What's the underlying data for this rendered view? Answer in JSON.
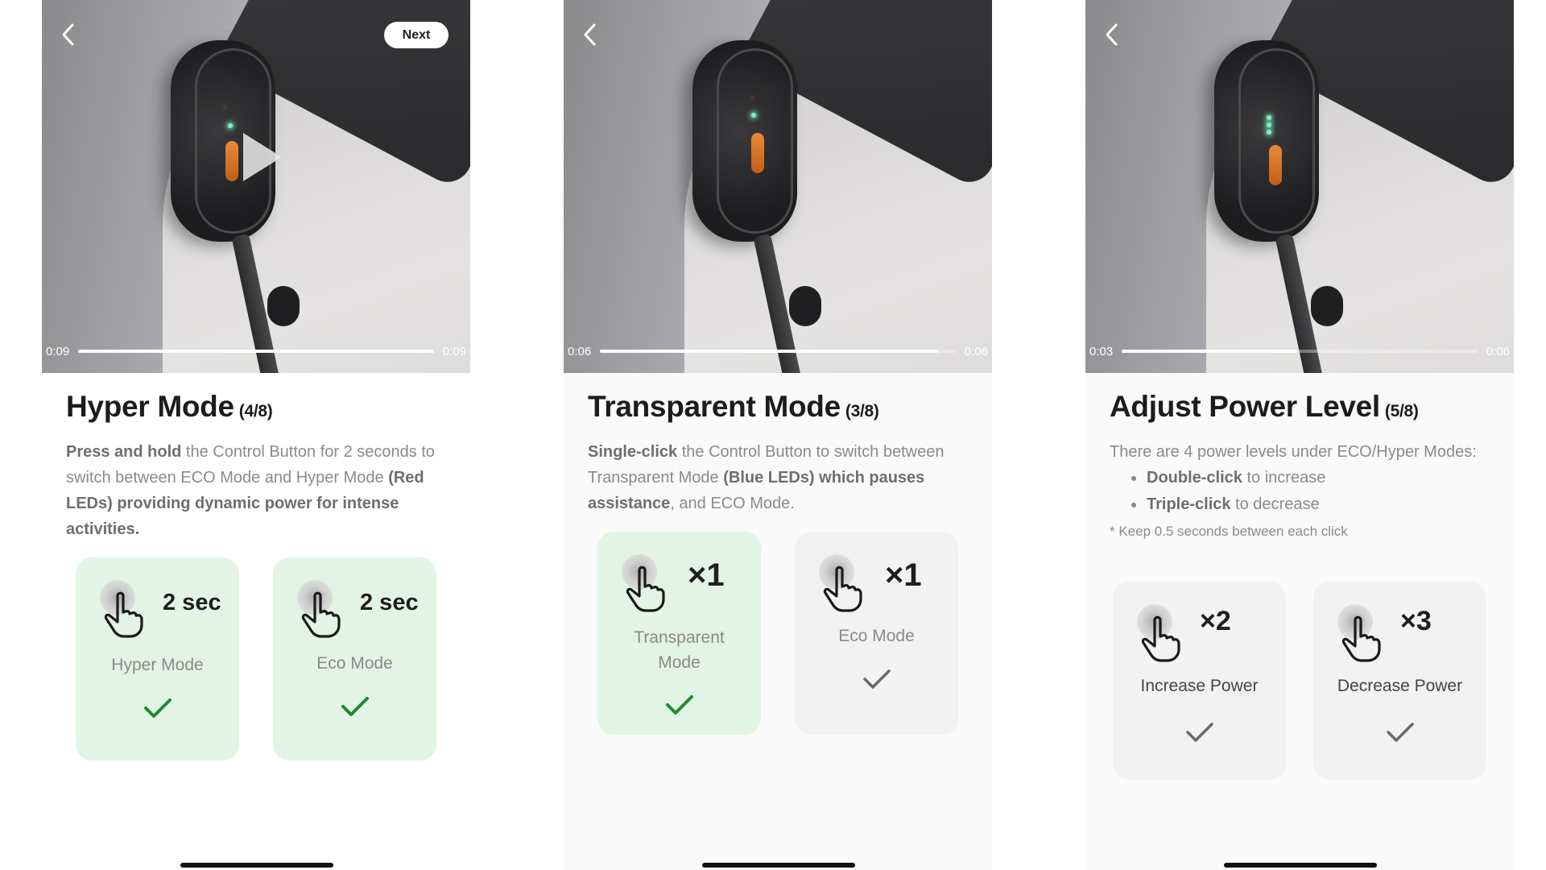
{
  "colors": {
    "selected_card_bg": "#e2f4e6",
    "unselected_card_bg": "#f2f2f2",
    "check_active": "#1f8a2e",
    "check_inactive": "#6a6a6a",
    "led": "#7ff0c0",
    "button_orange": "#d4712a"
  },
  "panels": [
    {
      "video": {
        "current_time": "0:09",
        "duration": "0:09",
        "progress": 1.0,
        "has_next": true,
        "next_label": "Next",
        "show_play": true
      },
      "title": "Hyper Mode",
      "step": "(4/8)",
      "description": [
        {
          "b": true,
          "t": "Press and hold"
        },
        {
          "b": false,
          "t": " the Control Button for 2 seconds to switch between ECO Mode and Hyper Mode "
        },
        {
          "b": true,
          "t": "(Red LEDs) providing dynamic power for intense activities."
        }
      ],
      "cards": [
        {
          "count": "2 sec",
          "label": "Hyper Mode",
          "active": true,
          "icon": "press-hold-icon"
        },
        {
          "count": "2 sec",
          "label": "Eco Mode",
          "active": true,
          "icon": "press-hold-icon"
        }
      ]
    },
    {
      "video": {
        "current_time": "0:06",
        "duration": "0:06",
        "progress": 0.95,
        "has_next": false,
        "show_play": false
      },
      "title": "Transparent Mode",
      "step": "(3/8)",
      "description": [
        {
          "b": true,
          "t": "Single-click"
        },
        {
          "b": false,
          "t": " the Control Button to switch between Transparent Mode "
        },
        {
          "b": true,
          "t": "(Blue LEDs) which pauses assistance"
        },
        {
          "b": false,
          "t": ", and ECO Mode."
        }
      ],
      "cards": [
        {
          "count": "×1",
          "label": "Transparent Mode",
          "active": true,
          "icon": "single-click-icon"
        },
        {
          "count": "×1",
          "label": "Eco Mode",
          "active": false,
          "icon": "single-click-icon"
        }
      ]
    },
    {
      "video": {
        "current_time": "0:03",
        "duration": "0:06",
        "progress": 0.49,
        "has_next": false,
        "show_play": false
      },
      "title": "Adjust Power Level",
      "step": "(5/8)",
      "intro": "There are 4 power levels under ECO/Hyper Modes:",
      "bullets": [
        {
          "b": "Double-click",
          "t": " to increase"
        },
        {
          "b": "Triple-click",
          "t": " to decrease"
        }
      ],
      "note": "* Keep 0.5 seconds between each click",
      "cards": [
        {
          "count": "×2",
          "label": "Increase Power",
          "active": false,
          "icon": "double-click-icon"
        },
        {
          "count": "×3",
          "label": "Decrease Power",
          "active": false,
          "icon": "triple-click-icon"
        }
      ]
    }
  ]
}
